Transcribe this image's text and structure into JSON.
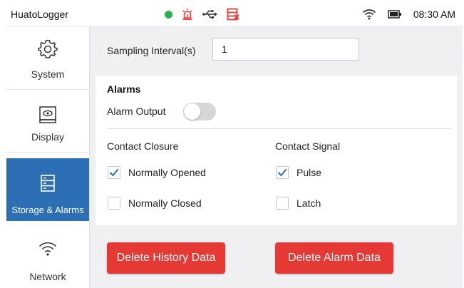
{
  "statusbar": {
    "app_title": "HuatoLogger",
    "time": "08:30 AM",
    "icons": [
      "connection-dot-icon",
      "alarm-icon",
      "usb-icon",
      "storage-icon",
      "wifi-icon",
      "battery-icon"
    ],
    "colors": {
      "green": "#2bb24c",
      "red": "#e53935"
    }
  },
  "sidebar": {
    "items": [
      {
        "label": "System",
        "icon": "gear-icon",
        "active": false
      },
      {
        "label": "Display",
        "icon": "display-icon",
        "active": false
      },
      {
        "label": "Storage & Alarms",
        "icon": "storage-icon",
        "active": true
      },
      {
        "label": "Network",
        "icon": "wifi-icon",
        "active": false
      }
    ],
    "active_color": "#2d6fb4"
  },
  "settings": {
    "sampling_label": "Sampling Interval(s)",
    "sampling_value": "1",
    "alarms_title": "Alarms",
    "alarm_output_label": "Alarm Output",
    "alarm_output_on": false,
    "contact_closure": {
      "title": "Contact Closure",
      "options": [
        {
          "label": "Normally Opened",
          "checked": true
        },
        {
          "label": "Normally Closed",
          "checked": false
        }
      ]
    },
    "contact_signal": {
      "title": "Contact Signal",
      "options": [
        {
          "label": "Pulse",
          "checked": true
        },
        {
          "label": "Latch",
          "checked": false
        }
      ]
    }
  },
  "actions": {
    "delete_history_label": "Delete History Data",
    "delete_alarm_label": "Delete Alarm Data",
    "button_color": "#e53935"
  }
}
